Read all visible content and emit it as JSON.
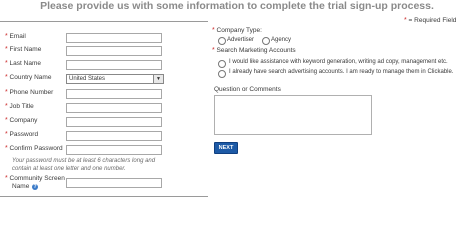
{
  "heading": "Please provide us with some information to complete the trial sign-up process.",
  "required_note": "= Required Field",
  "required_marker": "*",
  "left_fields": [
    {
      "label": "Email",
      "value": ""
    },
    {
      "label": "First Name",
      "value": ""
    },
    {
      "label": "Last Name",
      "value": ""
    },
    {
      "label": "Country Name",
      "value": "United States"
    },
    {
      "label": "Phone Number",
      "value": ""
    },
    {
      "label": "Job Title",
      "value": ""
    },
    {
      "label": "Company",
      "value": ""
    },
    {
      "label": "Password",
      "value": ""
    },
    {
      "label": "Confirm Password",
      "value": ""
    }
  ],
  "password_hint_line1": "Your password must be at least 6 characters long and",
  "password_hint_line2": "contain at least one letter and one number.",
  "community_label_line1": "Community Screen",
  "community_label_line2": "Name",
  "help_glyph": "?",
  "company_type": {
    "label": "Company Type:",
    "options": [
      "Advertiser",
      "Agency"
    ]
  },
  "search_marketing": {
    "label": "Search Marketing Accounts",
    "options": [
      "I would like assistance with keyword generation, writing ad copy, management etc.",
      "I already have search advertising accounts. I am ready to manage them in Clickable."
    ]
  },
  "questions_label": "Question or Comments",
  "next_button": "NEXT",
  "colors": {
    "required": "#cc2a2a",
    "button": "#1d5aa6",
    "heading": "#8a8a8a"
  }
}
